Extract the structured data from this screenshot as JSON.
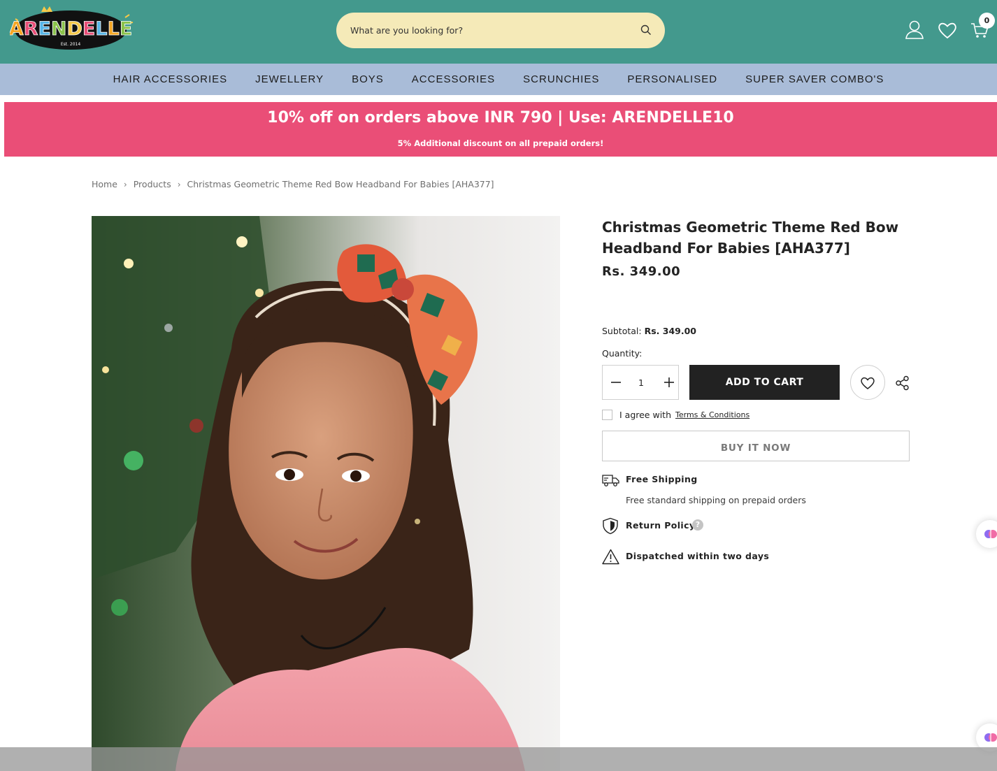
{
  "header": {
    "logo_text": "ARENDELLE",
    "logo_tagline": "Est. 2014",
    "search_placeholder": "What are you looking for?",
    "cart_count": "0"
  },
  "nav": {
    "items": [
      "HAIR ACCESSORIES",
      "JEWELLERY",
      "BOYS",
      "ACCESSORIES",
      "SCRUNCHIES",
      "PERSONALISED",
      "SUPER SAVER COMBO'S"
    ]
  },
  "promo": {
    "main": "10% off on orders above INR 790 | Use: ARENDELLE10",
    "sub": "5% Additional discount on all prepaid orders!",
    "background": "#ea4e77"
  },
  "breadcrumb": {
    "home": "Home",
    "products": "Products",
    "current": "Christmas Geometric Theme Red Bow Headband For Babies [AHA377]"
  },
  "product": {
    "title": "Christmas Geometric Theme Red Bow Headband For Babies [AHA377]",
    "price": "Rs. 349.00",
    "subtotal_label": "Subtotal:",
    "subtotal_value": "Rs. 349.00",
    "quantity_label": "Quantity:",
    "quantity_value": "1",
    "add_to_cart": "ADD TO CART",
    "agree_text": "I agree with",
    "terms_link": "Terms & Conditions",
    "buy_now": "BUY IT NOW"
  },
  "features": {
    "shipping_title": "Free Shipping",
    "shipping_text": "Free standard shipping on prepaid orders",
    "return_title": "Return Policy",
    "return_help": "?",
    "dispatch_title": "Dispatched within two days"
  },
  "colors": {
    "header_bg": "#43998d",
    "nav_bg": "#a9bcd8",
    "search_bg": "#f5eab8",
    "button_dark": "#222222"
  }
}
